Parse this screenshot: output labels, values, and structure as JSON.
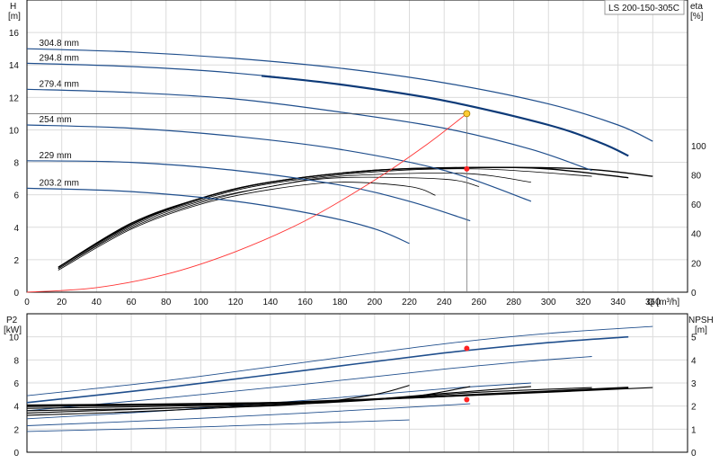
{
  "title": "LS 200-150-305C",
  "colors": {
    "curve": "#1f4e8c",
    "curve_bold": "#0d3a78",
    "system": "#ff3333",
    "duty_point_top": "#ffcc33",
    "duty_point": "#ff2222",
    "npsh": "#000000",
    "eta": "#000000",
    "grid": "#dcdcdc"
  },
  "chart_data": [
    {
      "type": "line",
      "panel": "head",
      "ylabel": "H",
      "yunit": "[m]",
      "y2label": "eta",
      "y2unit": "[%]",
      "xlabel": "Q [m³/h]",
      "xlim": [
        0,
        380
      ],
      "ylim": [
        0,
        18
      ],
      "y2lim": [
        0,
        100
      ],
      "xticks": [
        0,
        20,
        40,
        60,
        80,
        100,
        120,
        140,
        160,
        180,
        200,
        220,
        240,
        260,
        280,
        300,
        320,
        340,
        360
      ],
      "yticks": [
        0,
        2,
        4,
        6,
        8,
        10,
        12,
        14,
        16
      ],
      "y2ticks": [
        0,
        20,
        40,
        60,
        80,
        100
      ],
      "grid": true,
      "series": [
        {
          "name": "304.8 mm",
          "points": [
            [
              0,
              15.0
            ],
            [
              60,
              14.8
            ],
            [
              120,
              14.4
            ],
            [
              180,
              13.8
            ],
            [
              240,
              12.9
            ],
            [
              300,
              11.6
            ],
            [
              340,
              10.3
            ],
            [
              360,
              9.3
            ]
          ]
        },
        {
          "name": "294.8 mm",
          "points": [
            [
              0,
              14.1
            ],
            [
              60,
              13.9
            ],
            [
              120,
              13.5
            ],
            [
              180,
              12.8
            ],
            [
              240,
              11.8
            ],
            [
              300,
              10.3
            ],
            [
              330,
              9.2
            ],
            [
              346,
              8.4
            ]
          ],
          "bold_from": 135
        },
        {
          "name": "279.4 mm",
          "points": [
            [
              0,
              12.5
            ],
            [
              60,
              12.3
            ],
            [
              120,
              11.9
            ],
            [
              180,
              11.1
            ],
            [
              240,
              10.1
            ],
            [
              290,
              8.8
            ],
            [
              325,
              7.5
            ]
          ]
        },
        {
          "name": "254 mm",
          "points": [
            [
              0,
              10.3
            ],
            [
              60,
              10.1
            ],
            [
              120,
              9.6
            ],
            [
              180,
              8.8
            ],
            [
              240,
              7.5
            ],
            [
              290,
              5.6
            ]
          ]
        },
        {
          "name": "229 mm",
          "points": [
            [
              0,
              8.1
            ],
            [
              60,
              8.0
            ],
            [
              120,
              7.5
            ],
            [
              180,
              6.6
            ],
            [
              220,
              5.6
            ],
            [
              255,
              4.4
            ]
          ]
        },
        {
          "name": "203.2 mm",
          "points": [
            [
              0,
              6.4
            ],
            [
              60,
              6.2
            ],
            [
              120,
              5.6
            ],
            [
              170,
              4.7
            ],
            [
              200,
              3.9
            ],
            [
              220,
              3.0
            ]
          ]
        }
      ],
      "efficiency": [
        {
          "points": [
            [
              18,
              15
            ],
            [
              60,
              43
            ],
            [
              100,
              60
            ],
            [
              140,
              70
            ],
            [
              180,
              75
            ],
            [
              220,
              72
            ],
            [
              235,
              66
            ]
          ]
        },
        {
          "points": [
            [
              18,
              16
            ],
            [
              60,
              44
            ],
            [
              100,
              61
            ],
            [
              140,
              72
            ],
            [
              180,
              78
            ],
            [
              240,
              77
            ],
            [
              260,
              72
            ]
          ]
        },
        {
          "points": [
            [
              18,
              16
            ],
            [
              60,
              45
            ],
            [
              100,
              62
            ],
            [
              140,
              72
            ],
            [
              180,
              79
            ],
            [
              250,
              81
            ],
            [
              290,
              75
            ]
          ]
        },
        {
          "points": [
            [
              18,
              17
            ],
            [
              60,
              46
            ],
            [
              100,
              63
            ],
            [
              140,
              74
            ],
            [
              200,
              82
            ],
            [
              260,
              84
            ],
            [
              325,
              79
            ]
          ]
        },
        {
          "points": [
            [
              18,
              17
            ],
            [
              60,
              46
            ],
            [
              100,
              64
            ],
            [
              140,
              75
            ],
            [
              200,
              83
            ],
            [
              260,
              85
            ],
            [
              300,
              84
            ],
            [
              346,
              78
            ]
          ]
        },
        {
          "points": [
            [
              18,
              17
            ],
            [
              60,
              47
            ],
            [
              100,
              64
            ],
            [
              140,
              75
            ],
            [
              200,
              83
            ],
            [
              260,
              85
            ],
            [
              320,
              84
            ],
            [
              360,
              79
            ]
          ]
        }
      ],
      "system_curve": [
        [
          0,
          0
        ],
        [
          40,
          0.28
        ],
        [
          80,
          1.1
        ],
        [
          120,
          2.5
        ],
        [
          160,
          4.4
        ],
        [
          200,
          6.9
        ],
        [
          230,
          9.1
        ],
        [
          253,
          11.0
        ]
      ],
      "duty_point": {
        "q": 253,
        "h": 11.0,
        "eta": 84
      }
    },
    {
      "type": "line",
      "panel": "power_npsh",
      "ylabel": "P2",
      "yunit": "[kW]",
      "y2label": "NPSH",
      "y2unit": "[m]",
      "xlim": [
        0,
        380
      ],
      "ylim": [
        0,
        12
      ],
      "y2lim": [
        0,
        6
      ],
      "yticks": [
        0,
        2,
        4,
        6,
        8,
        10
      ],
      "y2ticks": [
        0,
        1,
        2,
        3,
        4,
        5
      ],
      "grid": true,
      "power": [
        {
          "points": [
            [
              0,
              4.9
            ],
            [
              80,
              6.2
            ],
            [
              160,
              7.8
            ],
            [
              240,
              9.4
            ],
            [
              300,
              10.3
            ],
            [
              360,
              10.9
            ]
          ]
        },
        {
          "points": [
            [
              0,
              4.3
            ],
            [
              80,
              5.6
            ],
            [
              160,
              7.1
            ],
            [
              240,
              8.6
            ],
            [
              300,
              9.5
            ],
            [
              346,
              10.0
            ]
          ]
        },
        {
          "points": [
            [
              0,
              3.6
            ],
            [
              80,
              4.7
            ],
            [
              160,
              5.9
            ],
            [
              240,
              7.2
            ],
            [
              290,
              7.9
            ],
            [
              325,
              8.3
            ]
          ]
        },
        {
          "points": [
            [
              0,
              2.9
            ],
            [
              80,
              3.6
            ],
            [
              160,
              4.5
            ],
            [
              240,
              5.5
            ],
            [
              290,
              6.0
            ]
          ]
        },
        {
          "points": [
            [
              0,
              2.3
            ],
            [
              80,
              2.8
            ],
            [
              160,
              3.4
            ],
            [
              220,
              3.9
            ],
            [
              255,
              4.2
            ]
          ]
        },
        {
          "points": [
            [
              0,
              1.8
            ],
            [
              80,
              2.1
            ],
            [
              160,
              2.5
            ],
            [
              220,
              2.8
            ]
          ]
        }
      ],
      "npsh": [
        {
          "points": [
            [
              0,
              1.6
            ],
            [
              60,
              1.75
            ],
            [
              120,
              1.95
            ],
            [
              160,
              2.1
            ],
            [
              200,
              2.5
            ],
            [
              220,
              2.9
            ]
          ]
        },
        {
          "points": [
            [
              0,
              1.7
            ],
            [
              80,
              1.9
            ],
            [
              160,
              2.1
            ],
            [
              220,
              2.4
            ],
            [
              255,
              2.85
            ]
          ]
        },
        {
          "points": [
            [
              0,
              1.8
            ],
            [
              100,
              1.95
            ],
            [
              180,
              2.2
            ],
            [
              240,
              2.55
            ],
            [
              290,
              2.85
            ]
          ]
        },
        {
          "points": [
            [
              0,
              1.9
            ],
            [
              120,
              2.05
            ],
            [
              200,
              2.3
            ],
            [
              260,
              2.6
            ],
            [
              325,
              2.8
            ]
          ]
        },
        {
          "points": [
            [
              0,
              2.0
            ],
            [
              120,
              2.1
            ],
            [
              200,
              2.3
            ],
            [
              260,
              2.5
            ],
            [
              346,
              2.8
            ]
          ]
        },
        {
          "points": [
            [
              0,
              2.05
            ],
            [
              140,
              2.15
            ],
            [
              220,
              2.35
            ],
            [
              300,
              2.6
            ],
            [
              360,
              2.8
            ]
          ]
        }
      ],
      "duty_power": 9.0,
      "duty_npsh": 2.28
    }
  ]
}
